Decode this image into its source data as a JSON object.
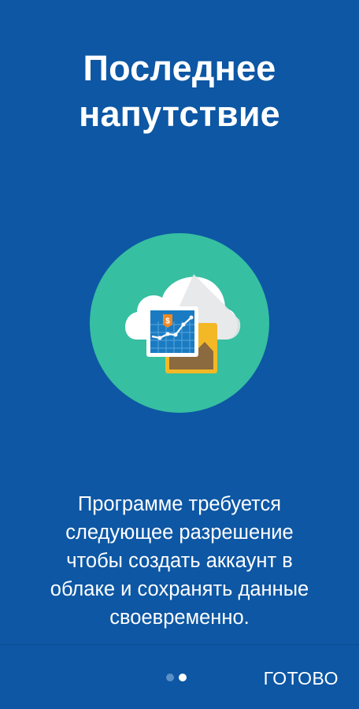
{
  "title": {
    "line1": "Последнее",
    "line2": "напутствие"
  },
  "illustration": {
    "icon": "cloud-chart-icon",
    "circle_color": "#36bfa1",
    "cloud_color": "#ffffff"
  },
  "message": {
    "line1": "Программе требуется",
    "line2": "следующее разрешение",
    "line3": "чтобы создать аккаунт в",
    "line4": "облаке и сохранять данные",
    "line5": "своевременно."
  },
  "pager": {
    "total": 2,
    "current": 2
  },
  "footer": {
    "done_label": "ГОТОВО"
  },
  "colors": {
    "background": "#0d57a4",
    "accent": "#36bfa1"
  }
}
